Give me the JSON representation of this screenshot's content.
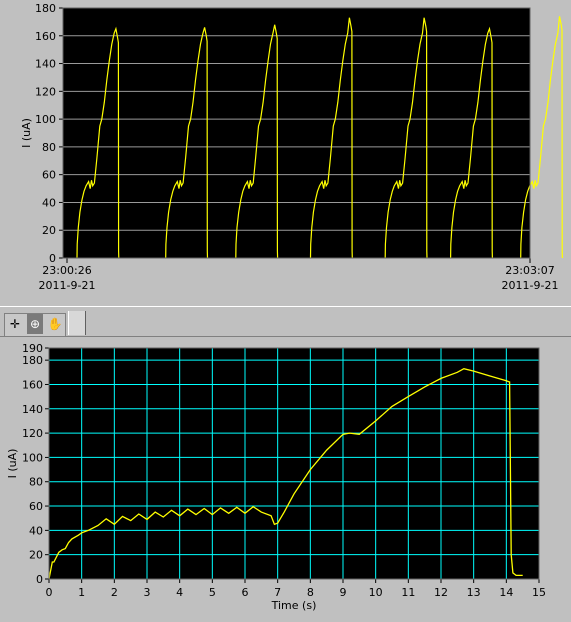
{
  "colors": {
    "plot_bg": "#000000",
    "trace": "#ffff00",
    "top_grid": "#9a9a9a",
    "bottom_grid": "#00ffff",
    "bottom_plot_bg": "#000000",
    "panel": "#c0c0c0"
  },
  "toolbar": {
    "tools": [
      {
        "name": "cursor-tool-icon",
        "glyph": "✛"
      },
      {
        "name": "zoom-tool-icon",
        "glyph": "⊕"
      },
      {
        "name": "pan-tool-icon",
        "glyph": "✋"
      }
    ]
  },
  "chart_data": [
    {
      "type": "line",
      "title": "",
      "xlabel": "",
      "ylabel": "I (uA)",
      "ylim": [
        0,
        180
      ],
      "yticks": [
        0,
        20,
        40,
        60,
        80,
        100,
        120,
        140,
        160,
        180
      ],
      "xlim_labels": [
        {
          "time": "23:00:26",
          "date": "2011-9-21"
        },
        {
          "time": "23:03:07",
          "date": "2011-9-21"
        }
      ],
      "grid": "horizontal",
      "cycles": 7,
      "cycle_start_fraction": [
        0.03,
        0.22,
        0.37,
        0.53,
        0.69,
        0.83,
        0.98
      ],
      "cycle_peak": [
        165,
        166,
        168,
        173,
        173,
        165,
        174
      ],
      "plateau": 52
    },
    {
      "type": "line",
      "title": "",
      "xlabel": "Time (s)",
      "ylabel": "I (uA)",
      "xlim": [
        0,
        15
      ],
      "ylim": [
        0,
        190
      ],
      "xticks": [
        0,
        1,
        2,
        3,
        4,
        5,
        6,
        7,
        8,
        9,
        10,
        11,
        12,
        13,
        14,
        15
      ],
      "yticks": [
        0,
        20,
        40,
        60,
        80,
        100,
        120,
        140,
        160,
        180,
        190
      ],
      "grid": "both",
      "series": [
        {
          "x": [
            0,
            0.1,
            0.15,
            0.3,
            0.4,
            0.5,
            0.6,
            0.7,
            0.9,
            1.0,
            1.2,
            1.5,
            2.0,
            2.5,
            3.0,
            3.5,
            4.0,
            4.5,
            5.0,
            5.5,
            6.0,
            6.5,
            6.8,
            6.9,
            7.0,
            7.2,
            7.5,
            8.0,
            8.5,
            9.0,
            9.2,
            9.5,
            10.0,
            10.5,
            11.0,
            11.5,
            12.0,
            12.5,
            12.7,
            13.0,
            13.5,
            14.0,
            14.1,
            14.15,
            14.2,
            14.3,
            14.5
          ],
          "y": [
            0,
            14,
            14,
            22,
            24,
            25,
            30,
            33,
            36,
            38,
            40,
            44,
            45,
            48,
            49,
            51,
            52,
            53,
            53,
            54,
            54,
            55,
            52,
            45,
            46,
            55,
            70,
            90,
            106,
            119,
            120,
            119,
            130,
            142,
            150,
            158,
            165,
            170,
            173,
            171,
            167,
            163,
            162,
            20,
            5,
            3,
            3
          ]
        }
      ]
    }
  ]
}
